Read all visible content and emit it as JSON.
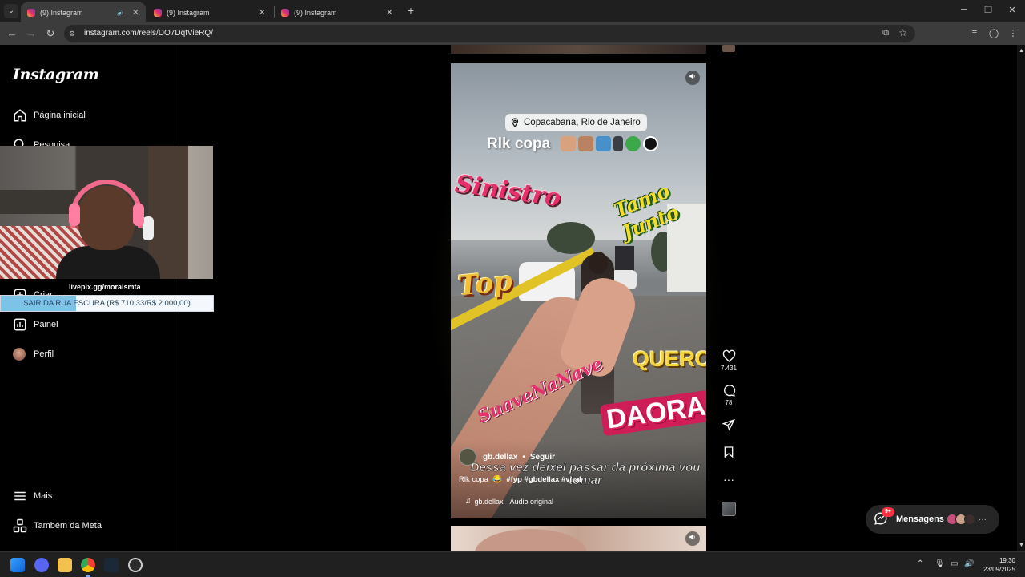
{
  "browser": {
    "tabs": [
      {
        "label": "(9) Instagram",
        "active": true,
        "audio": true
      },
      {
        "label": "(9) Instagram",
        "active": false
      },
      {
        "label": "(9) Instagram",
        "active": false
      }
    ],
    "url": "instagram.com/reels/DO7DqfVieRQ/"
  },
  "sidebar": {
    "logo": "Instagram",
    "items": [
      {
        "label": "Página inicial",
        "icon": "home-icon"
      },
      {
        "label": "Pesquisa",
        "icon": "search-icon"
      },
      {
        "label": "Criar",
        "icon": "create-icon"
      },
      {
        "label": "Painel",
        "icon": "dashboard-icon"
      },
      {
        "label": "Perfil",
        "icon": "profile-avatar"
      }
    ],
    "bottom_items": [
      {
        "label": "Mais",
        "icon": "menu-icon"
      },
      {
        "label": "Também da Meta",
        "icon": "meta-icon"
      }
    ]
  },
  "stream_overlay": {
    "donation_link": "livepix.gg/moraismta",
    "goal_text": "SAIR DA RUA ESCURA (R$ 710,33/R$ 2.000,00)",
    "goal_progress": 0.355
  },
  "reel": {
    "location": "Copacabana, Rio de Janeiro",
    "title": "Rlk copa",
    "stickers": [
      "Sinistro",
      "Tamo Junto",
      "Top",
      "QUERO",
      "SuaveNaNave",
      "DAORA"
    ],
    "author": "gb.dellax",
    "follow_label": "Seguir",
    "subtitle": "Dessa vez deixei passar da próxima vou tomar",
    "description": "Rlk copa",
    "hashtags": "#fyp #gbdellax #viral",
    "audio": "gb.dellax · Áudio original"
  },
  "actions": {
    "likes": "7.431",
    "comments": "78"
  },
  "messages": {
    "label": "Mensagens",
    "badge": "9+"
  },
  "taskbar": {
    "time": "19:30",
    "date": "23/09/2025"
  },
  "colors": {
    "instagram_gradient": [
      "#f9b12b",
      "#e1306c",
      "#833ab4"
    ],
    "notification_red": "#ff3040",
    "goal_fill": "#7dc3e8"
  }
}
